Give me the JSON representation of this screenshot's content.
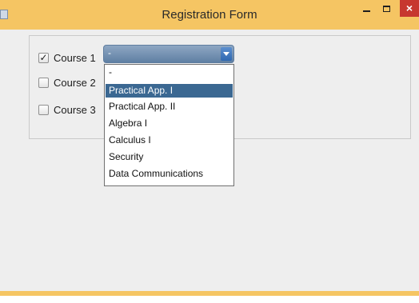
{
  "window": {
    "title": "Registration Form",
    "minimize_icon": "minimize-icon",
    "maximize_icon": "maximize-icon",
    "close_label": "×"
  },
  "courses": [
    {
      "label": "Course 1",
      "checked": true
    },
    {
      "label": "Course 2",
      "checked": false
    },
    {
      "label": "Course 3",
      "checked": false
    }
  ],
  "combo": {
    "value": "-",
    "arrow_icon": "chevron-down-icon"
  },
  "dropdown": {
    "options": [
      "-",
      "Practical App. I",
      "Practical App. II",
      "Algebra I",
      "Calculus I",
      "Security",
      "Data Communications"
    ],
    "selected_index": 1
  },
  "colors": {
    "titlebar": "#f5c563",
    "selection": "#3b6892",
    "close_button": "#c7372f"
  }
}
